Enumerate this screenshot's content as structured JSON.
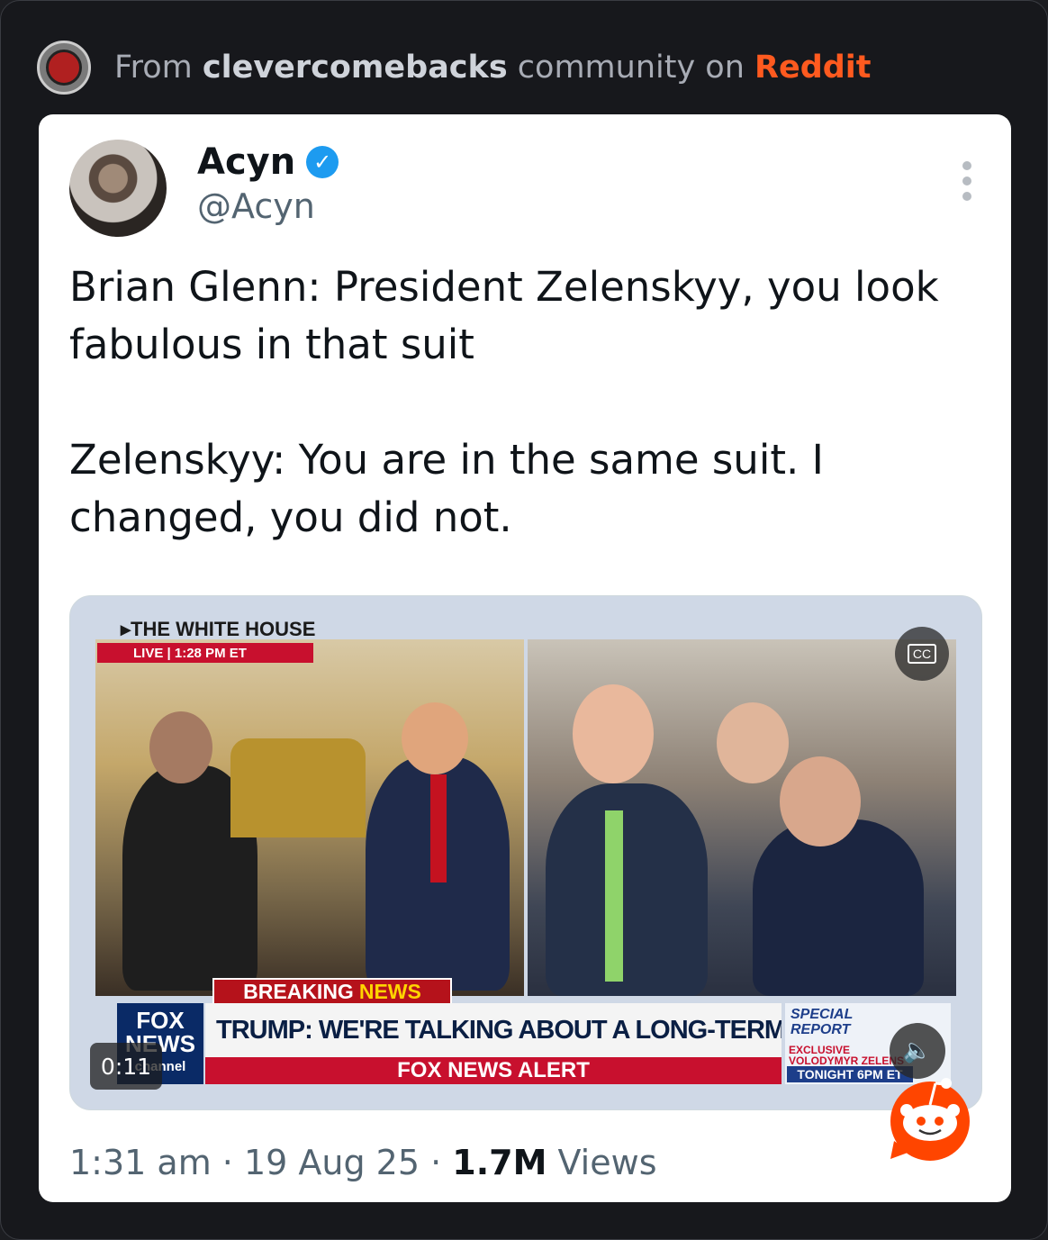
{
  "header": {
    "prefix": "From ",
    "community": "clevercomebacks",
    "middle": " community on ",
    "platform": "Reddit"
  },
  "tweet": {
    "author_name": "Acyn",
    "author_handle": "@Acyn",
    "line1": "Brian Glenn: President Zelenskyy, you look fabulous in that suit",
    "line2": "Zelenskyy: You are in the same suit. I changed, you did not.",
    "time": "1:31 am",
    "separator": " · ",
    "date": "19 Aug 25",
    "views_count": "1.7M",
    "views_label": " Views"
  },
  "video": {
    "timer": "0:11",
    "cc_label": "CC",
    "broadcast": {
      "location": "▸THE WHITE HOUSE",
      "live": "LIVE  |  1:28 PM ET",
      "breaking": "BREAKING",
      "breaking_news": "NEWS",
      "headline": "TRUMP: WE'RE TALKING ABOUT A LONG-TERM PEACE DEAL",
      "alert": "FOX NEWS ALERT",
      "logo_line1": "FOX",
      "logo_line2": "NEWS",
      "logo_line3": "channel",
      "special_line1": "SPECIAL",
      "special_line2": "REPORT",
      "exclusive_line1": "EXCLUSIVE",
      "exclusive_line2": "VOLODYMYR ZELENS",
      "tonight": "TONIGHT 6PM ET"
    }
  },
  "colors": {
    "reddit_orange": "#ff5a1f",
    "verified_blue": "#1d9bf0",
    "fox_red": "#c8102e",
    "fox_navy": "#0a2a66"
  },
  "icons": {
    "community_avatar": "community-avatar-icon",
    "verified": "verified-badge-icon",
    "menu": "more-options-icon",
    "cc": "closed-captions-icon",
    "mute": "speaker-icon",
    "reddit": "reddit-snoo-icon"
  }
}
